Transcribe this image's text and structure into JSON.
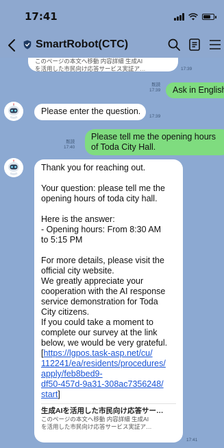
{
  "status_bar": {
    "time": "17:41"
  },
  "header": {
    "back_label": "<",
    "title": "SmartRobot(CTC)",
    "icons": [
      "back-arrow-icon",
      "shield-icon",
      "search-icon",
      "notes-icon",
      "menu-icon"
    ]
  },
  "messages": {
    "top_preview": {
      "lines": [
        "このページの本文へ移動 内容詳細 生成AI",
        "を活用した市民向け応答サービス実証ア…"
      ],
      "time": "17:39"
    },
    "ask_english": {
      "text": "Ask in English",
      "read": "既読",
      "time": "17:39"
    },
    "enter_question": {
      "text": "Please enter the question.",
      "time": "17:39"
    },
    "user_question": {
      "lines": [
        "Please tell me the opening hours",
        "of Toda City Hall."
      ],
      "read": "既読",
      "time": "17:40"
    },
    "bot_answer": {
      "lines": [
        "Thank you for reaching out.",
        "",
        "Your question: please tell me the",
        "opening hours of toda city hall.",
        "",
        "Here is the answer:",
        "- Opening hours: From 8:30 AM",
        "to 5:15 PM",
        "",
        "For more details, please visit the",
        "official city website.",
        "We greatly appreciate your",
        "cooperation with the AI response",
        "service demonstration for Toda",
        "City citizens.",
        "If you could take a moment to",
        "complete our survey at the link",
        "below, we would be very grateful."
      ],
      "link_open": "[",
      "link_lines": [
        "https://lgpos.task-asp.net/cu/",
        "112241/ea/residents/procedures/",
        "apply/feb8bed9-",
        "df50-457d-9a31-308ac7356248/",
        "start"
      ],
      "link_close": "]",
      "preview_title": "生成AIを活用した市民向け応答サー…",
      "preview_lines": [
        "このページの本文へ移動 内容詳細 生成AI",
        "を活用した市民向け応答サービス実証ア…"
      ],
      "time": "17:41"
    }
  },
  "colors": {
    "background": "#8ca9d2",
    "user_bubble": "#7fdc7f",
    "bot_bubble": "#ffffff",
    "link": "#1a55d6"
  }
}
